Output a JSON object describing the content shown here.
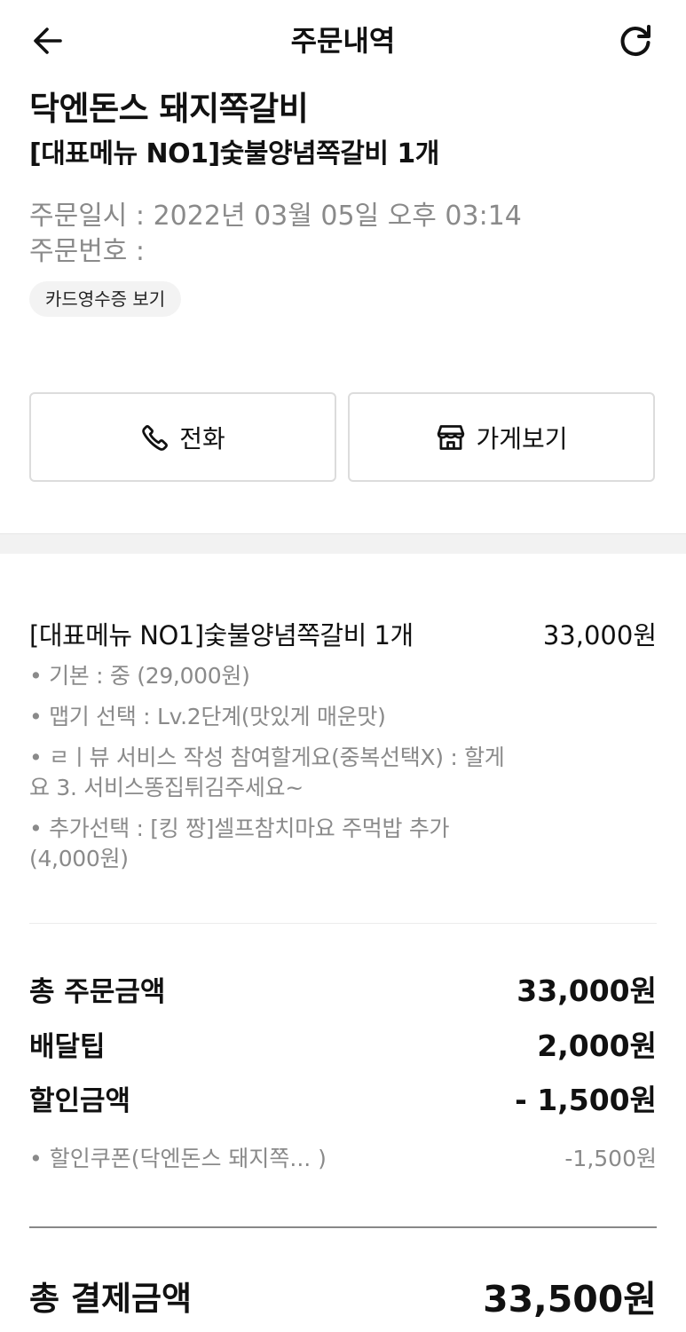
{
  "header": {
    "title": "주문내역",
    "back_icon": "arrow-left-icon",
    "refresh_icon": "refresh-icon"
  },
  "store": {
    "name": "닥엔돈스 돼지쪽갈비",
    "representative_menu": "[대표메뉴 NO1]숯불양념쪽갈비 1개"
  },
  "order": {
    "date_label": "주문일시 :",
    "date_value": "2022년 03월 05일 오후 03:14",
    "number_label": "주문번호 :",
    "number_value": "",
    "receipt_button": "카드영수증 보기"
  },
  "actions": {
    "call_label": "전화",
    "call_icon": "phone-icon",
    "store_label": "가게보기",
    "store_icon": "storefront-icon"
  },
  "item": {
    "name": "[대표메뉴 NO1]숯불양념쪽갈비 1개",
    "price": "33,000원",
    "options": [
      "• 기본 : 중 (29,000원)",
      "• 맵기 선택 : Lv.2단계(맛있게 매운맛)",
      "• ㄹㅣ뷰 서비스 작성 참여할게요(중복선택X) : 할게요 3. 서비스똥집튀김주세요~",
      "• 추가선택 : [킹 짱]셀프참치마요 주먹밥 추가 (4,000원)"
    ]
  },
  "summary": {
    "total_order_label": "총 주문금액",
    "total_order_value": "33,000원",
    "delivery_tip_label": "배달팁",
    "delivery_tip_value": "2,000원",
    "discount_label": "할인금액",
    "discount_value": "- 1,500원",
    "coupon_label": "• 할인쿠폰(닥엔돈스 돼지쪽... )",
    "coupon_value": "-1,500원",
    "total_payment_label": "총 결제금액",
    "total_payment_value": "33,500원"
  }
}
